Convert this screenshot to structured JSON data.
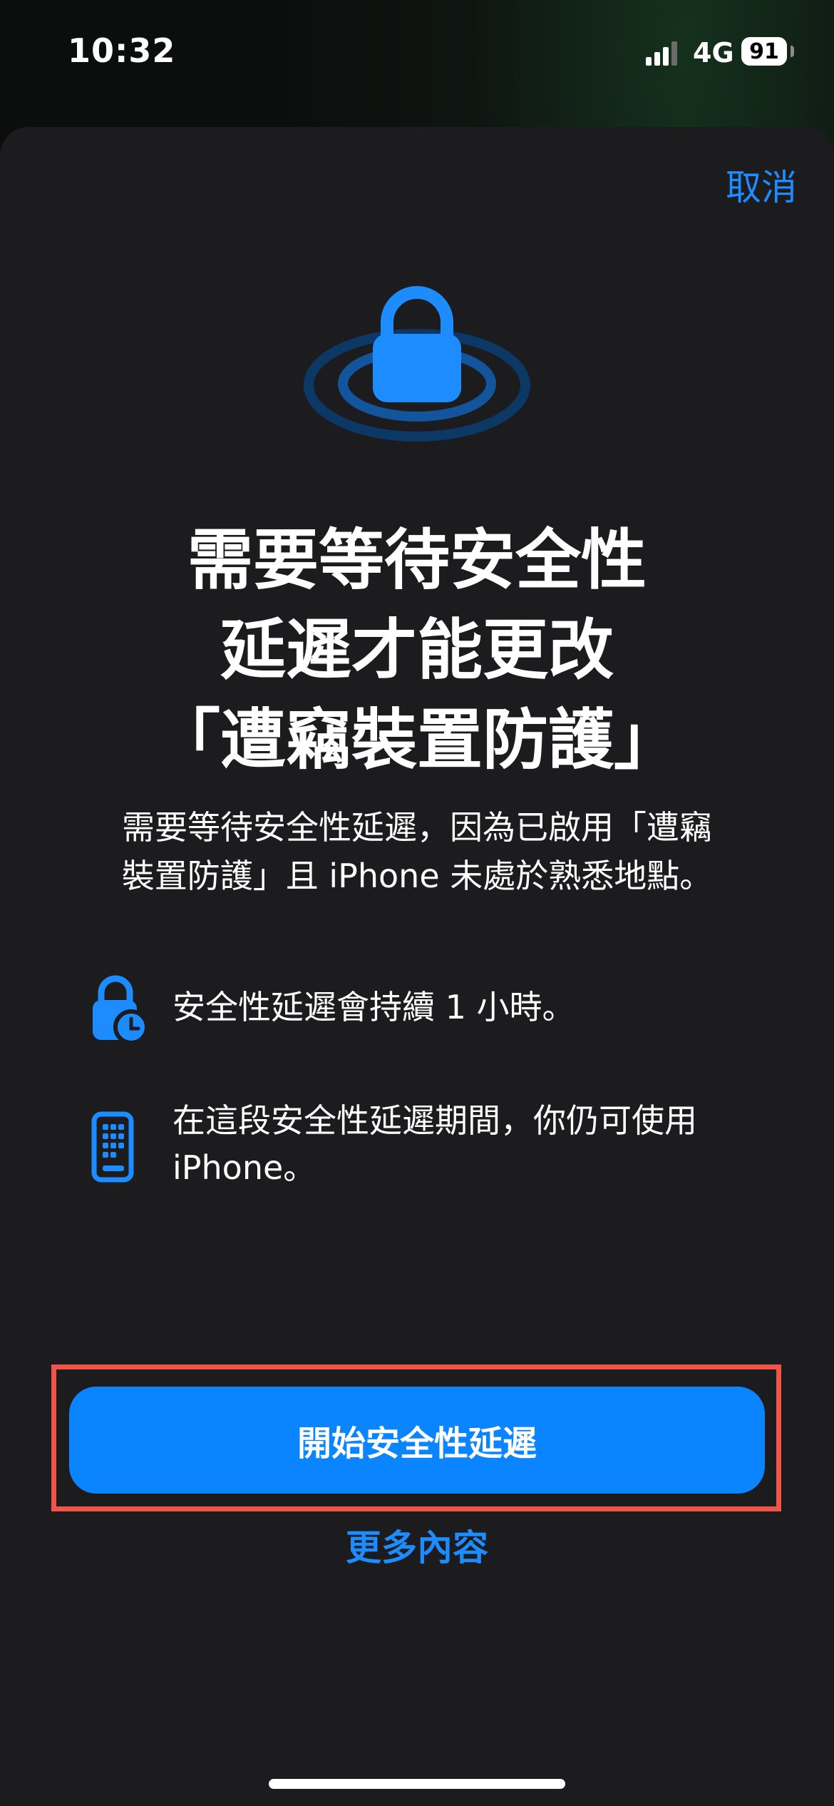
{
  "status_bar": {
    "time": "10:32",
    "network": "4G",
    "battery": "91"
  },
  "sheet": {
    "cancel_label": "取消",
    "title_lines": [
      "需要等待安全性",
      "延遲才能更改",
      "「遭竊裝置防護」"
    ],
    "subtitle_lines": [
      "需要等待安全性延遲，因為已啟用「遭竊",
      "裝置防護」且 iPhone 未處於熟悉地點。"
    ],
    "info_items": [
      {
        "icon": "lock-clock-icon",
        "lines": [
          "安全性延遲會持續 1 小時。"
        ]
      },
      {
        "icon": "iphone-icon",
        "lines": [
          "在這段安全性延遲期間，你仍可使用",
          "iPhone。"
        ]
      }
    ],
    "primary_button_label": "開始安全性延遲",
    "more_link_label": "更多內容"
  },
  "colors": {
    "accent": "#0a84ff",
    "link": "#1d8cff",
    "sheet_background": "#1c1c1e",
    "highlight_border": "#f2544b"
  }
}
